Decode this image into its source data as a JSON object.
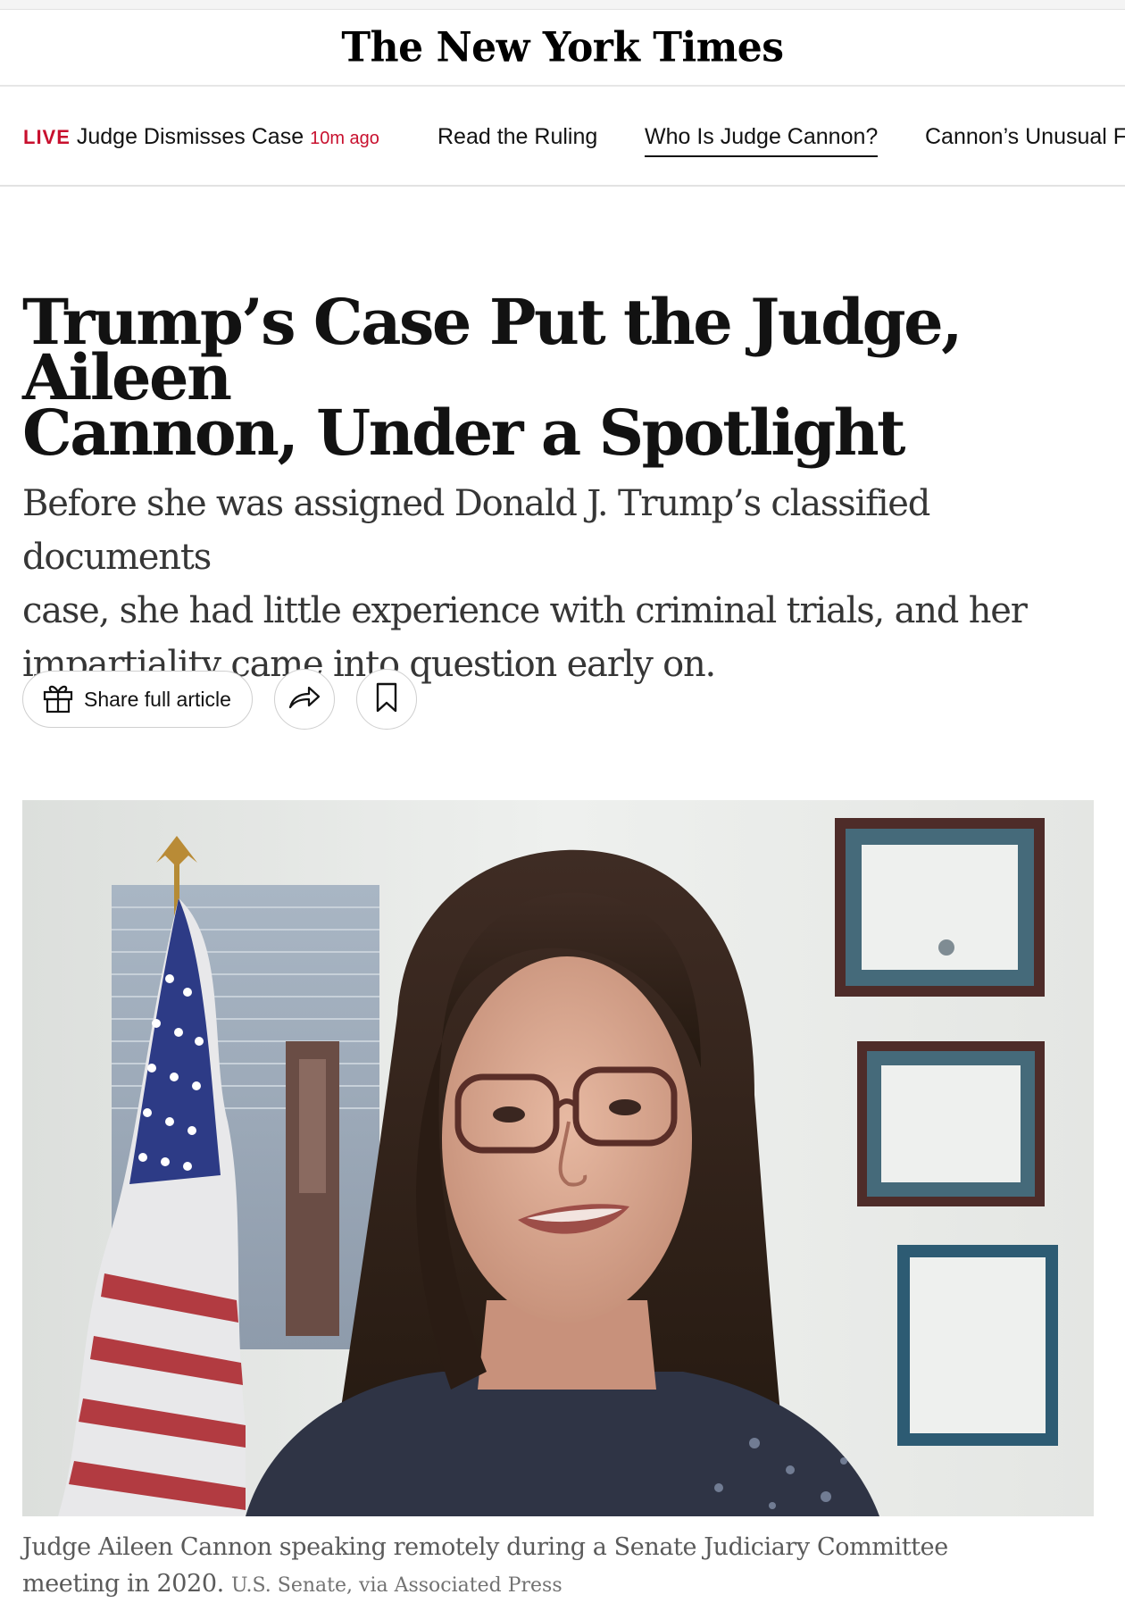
{
  "masthead": {
    "logo_text": "The New York Times"
  },
  "live_bar": {
    "live_label": "LIVE",
    "live_headline": "Judge Dismisses Case",
    "live_time_ago": "10m ago",
    "links": [
      {
        "label": "Read the Ruling"
      },
      {
        "label": "Who Is Judge Cannon?"
      },
      {
        "label": "Cannon’s Unusual F"
      }
    ]
  },
  "article": {
    "headline_line1": "Trump’s Case Put the Judge, Aileen",
    "headline_line2": "Cannon, Under a Spotlight",
    "summary_line1": "Before she was assigned Donald J. Trump’s classified documents",
    "summary_line2": "case, she had little experience with criminal trials, and her",
    "summary_line3": "impartiality came into question early on."
  },
  "actions": {
    "share_full_label": "Share full article",
    "share_icon": "share-arrow-icon",
    "save_icon": "bookmark-icon",
    "gift_icon": "gift-icon"
  },
  "photo": {
    "caption_line1": "Judge Aileen Cannon speaking remotely during a Senate Judiciary Committee",
    "caption_line2": "meeting in 2020.",
    "credit": "U.S. Senate, via Associated Press"
  },
  "colors": {
    "live_red": "#c8102e",
    "text": "#121212",
    "border": "#e2e2e2"
  }
}
